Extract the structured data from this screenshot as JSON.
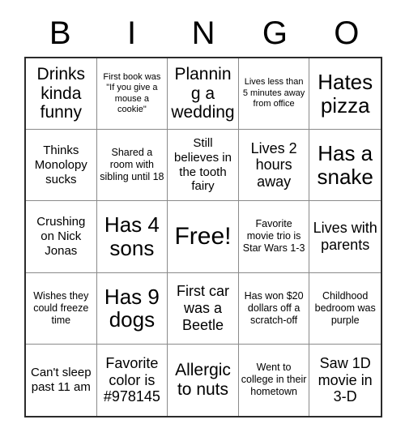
{
  "card": {
    "title": "BINGO",
    "header_letters": [
      "B",
      "I",
      "N",
      "G",
      "O"
    ],
    "free_space_label": "Free!",
    "colors": {
      "background": "#ffffff",
      "text": "#000000",
      "grid_line": "#8a8a8a",
      "outer_border": "#2b2b2b"
    },
    "cells": [
      {
        "text": "Drinks kinda funny",
        "size": "xl",
        "free": false
      },
      {
        "text": "First book was \"If you give a mouse a cookie\"",
        "size": "xs",
        "free": false
      },
      {
        "text": "Planning a wedding",
        "size": "xl",
        "free": false
      },
      {
        "text": "Lives less than 5 minutes away from office",
        "size": "xs",
        "free": false
      },
      {
        "text": "Hates pizza",
        "size": "xxl",
        "free": false
      },
      {
        "text": "Thinks Monolopy sucks",
        "size": "md",
        "free": false
      },
      {
        "text": "Shared a room with sibling until 18",
        "size": "sm",
        "free": false
      },
      {
        "text": "Still believes in the tooth fairy",
        "size": "md",
        "free": false
      },
      {
        "text": "Lives 2 hours away",
        "size": "lg",
        "free": false
      },
      {
        "text": "Has a snake",
        "size": "xxl",
        "free": false
      },
      {
        "text": "Crushing on Nick Jonas",
        "size": "md",
        "free": false
      },
      {
        "text": "Has 4 sons",
        "size": "xxl",
        "free": false
      },
      {
        "text": "Free!",
        "size": "huge",
        "free": true
      },
      {
        "text": "Favorite movie trio is Star Wars 1-3",
        "size": "sm",
        "free": false
      },
      {
        "text": "Lives with parents",
        "size": "lg",
        "free": false
      },
      {
        "text": "Wishes they could freeze time",
        "size": "sm",
        "free": false
      },
      {
        "text": "Has 9 dogs",
        "size": "xxl",
        "free": false
      },
      {
        "text": "First car was a Beetle",
        "size": "lg",
        "free": false
      },
      {
        "text": "Has won $20 dollars off a scratch-off",
        "size": "sm",
        "free": false
      },
      {
        "text": "Childhood bedroom was purple",
        "size": "sm",
        "free": false
      },
      {
        "text": "Can't sleep past 11 am",
        "size": "md",
        "free": false
      },
      {
        "text": "Favorite color is #978145",
        "size": "lg",
        "free": false
      },
      {
        "text": "Allergic to nuts",
        "size": "xl",
        "free": false
      },
      {
        "text": "Went to college in their hometown",
        "size": "sm",
        "free": false
      },
      {
        "text": "Saw 1D movie in 3-D",
        "size": "lg",
        "free": false
      }
    ]
  }
}
